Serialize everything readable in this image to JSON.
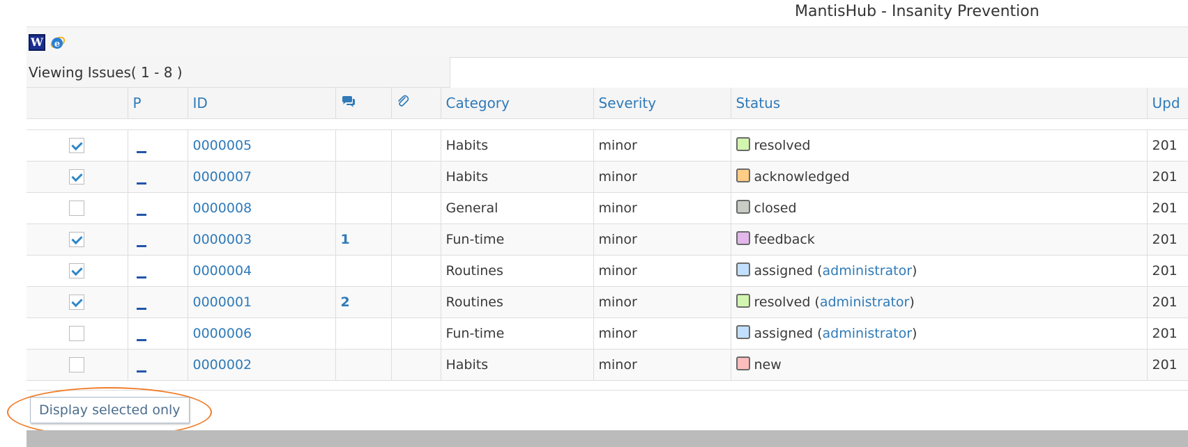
{
  "site": {
    "title": "MantisHub - Insanity Prevention"
  },
  "export": {
    "icons": [
      "word-export-icon",
      "ie-export-icon"
    ],
    "word_letter": "W"
  },
  "viewing": {
    "label": "Viewing Issues( 1 - 8 )"
  },
  "table": {
    "columns": {
      "priority": "P",
      "id": "ID",
      "notes_icon": "comments-icon",
      "attachments_icon": "paperclip-icon",
      "category": "Category",
      "severity": "Severity",
      "status": "Status",
      "updated": "Upd"
    },
    "rows": [
      {
        "checked": true,
        "id": "0000005",
        "notes": "",
        "category": "Habits",
        "severity": "minor",
        "status": "resolved",
        "handler": "",
        "status_color": "#d2f5b0",
        "updated": "201"
      },
      {
        "checked": true,
        "id": "0000007",
        "notes": "",
        "category": "Habits",
        "severity": "minor",
        "status": "acknowledged",
        "handler": "",
        "status_color": "#ffcd85",
        "updated": "201"
      },
      {
        "checked": false,
        "id": "0000008",
        "notes": "",
        "category": "General",
        "severity": "minor",
        "status": "closed",
        "handler": "",
        "status_color": "#c9ccc4",
        "updated": "201"
      },
      {
        "checked": true,
        "id": "0000003",
        "notes": "1",
        "category": "Fun-time",
        "severity": "minor",
        "status": "feedback",
        "handler": "",
        "status_color": "#e3b7eb",
        "updated": "201"
      },
      {
        "checked": true,
        "id": "0000004",
        "notes": "",
        "category": "Routines",
        "severity": "minor",
        "status": "assigned",
        "handler": "administrator",
        "status_color": "#c2dfff",
        "updated": "201"
      },
      {
        "checked": true,
        "id": "0000001",
        "notes": "2",
        "category": "Routines",
        "severity": "minor",
        "status": "resolved",
        "handler": "administrator",
        "status_color": "#d2f5b0",
        "updated": "201"
      },
      {
        "checked": false,
        "id": "0000006",
        "notes": "",
        "category": "Fun-time",
        "severity": "minor",
        "status": "assigned",
        "handler": "administrator",
        "status_color": "#c2dfff",
        "updated": "201"
      },
      {
        "checked": false,
        "id": "0000002",
        "notes": "",
        "category": "Habits",
        "severity": "minor",
        "status": "new",
        "handler": "",
        "status_color": "#fcbdbd",
        "updated": "201"
      }
    ]
  },
  "actions": {
    "display_selected_label": "Display selected only",
    "highlight_color": "#f07d2a"
  }
}
